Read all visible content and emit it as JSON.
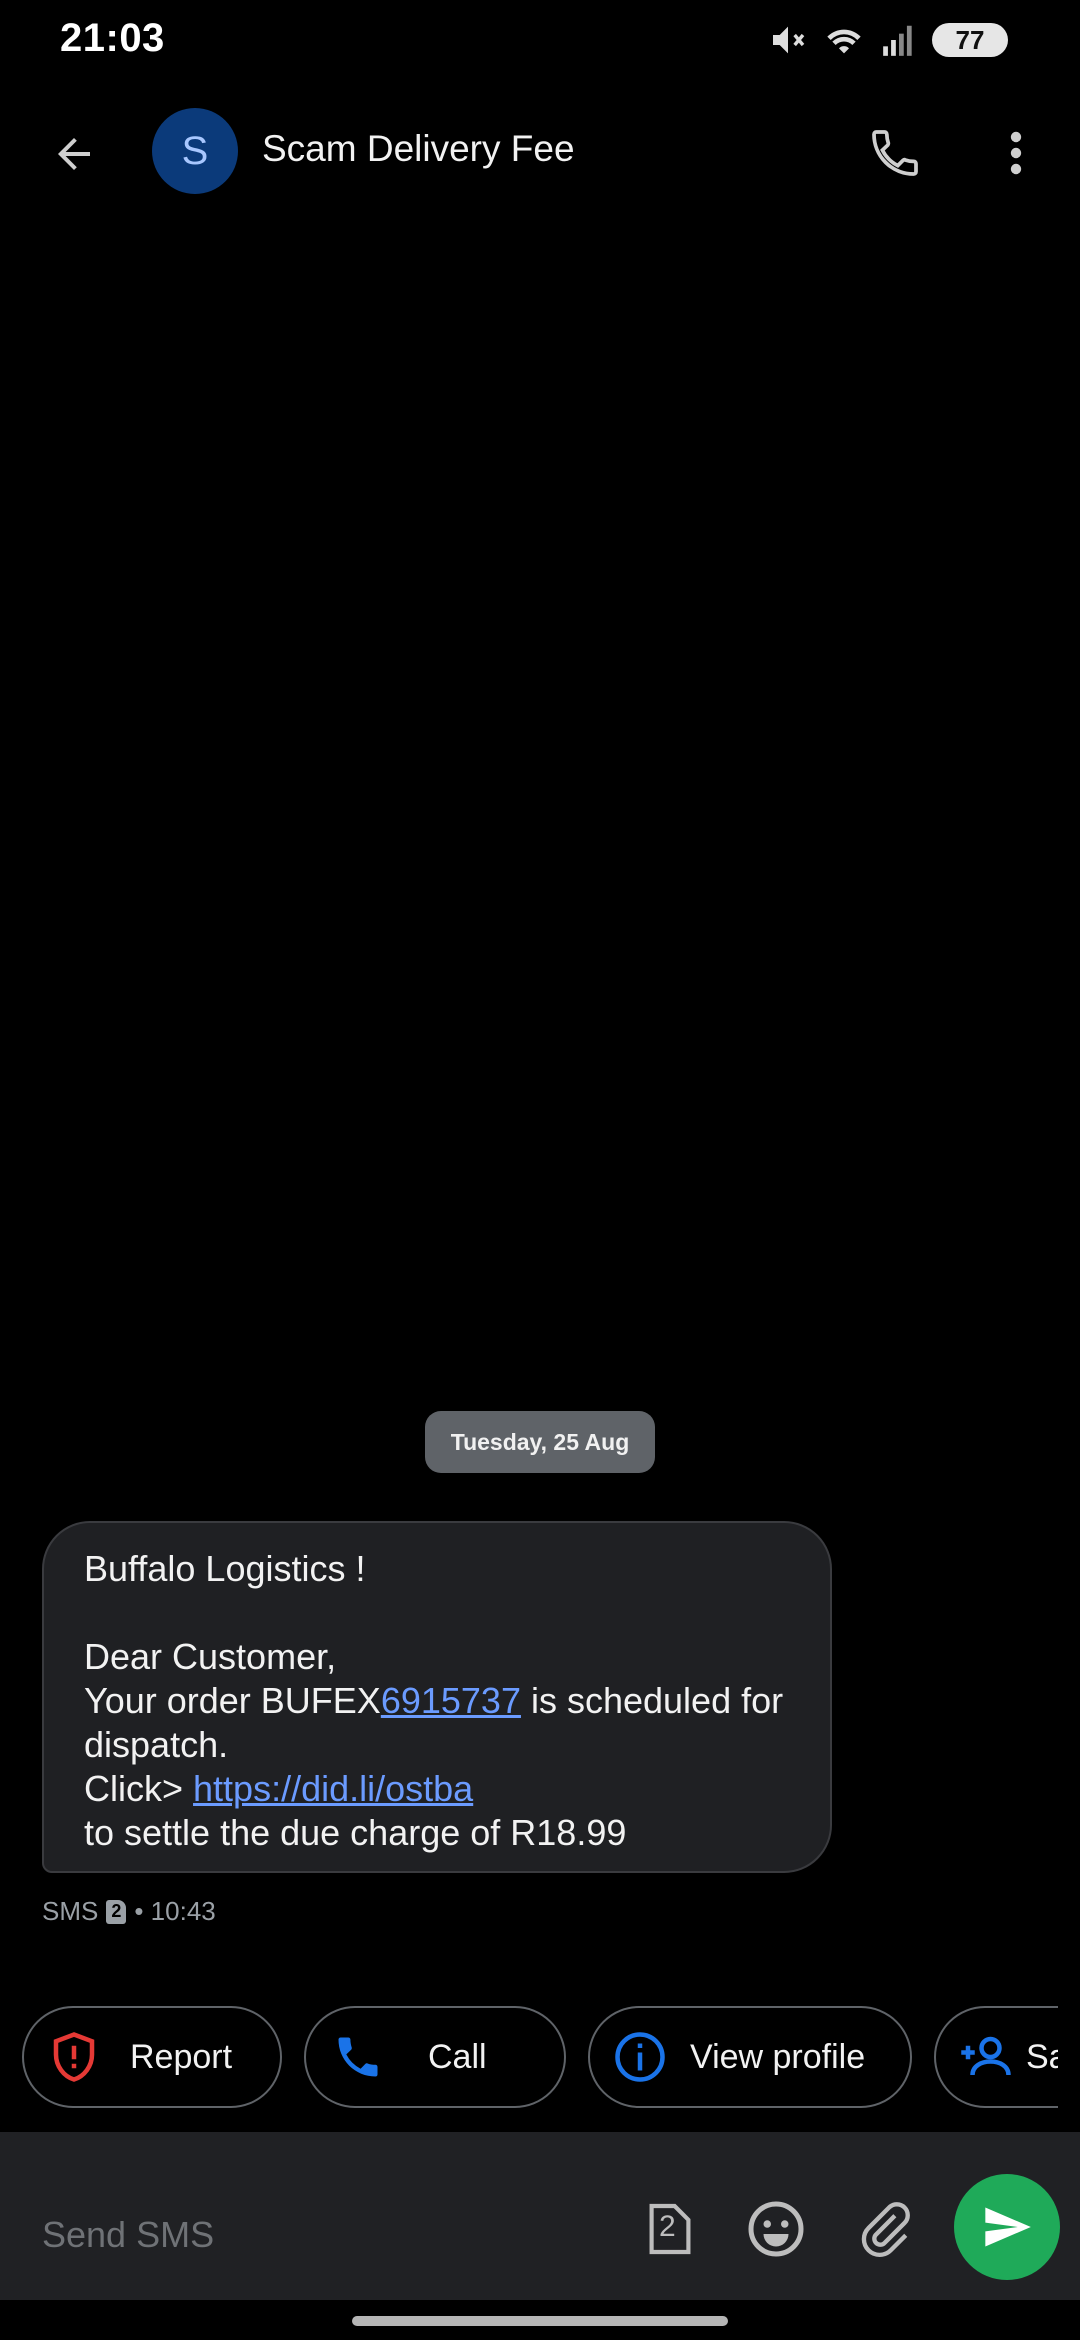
{
  "status_bar": {
    "time": "21:03",
    "battery": "77",
    "icons": [
      "mute-icon",
      "wifi-icon",
      "signal-icon",
      "battery-icon"
    ]
  },
  "header": {
    "avatar_letter": "S",
    "title": "Scam Delivery Fee",
    "icons": [
      "back-arrow-icon",
      "phone-icon",
      "more-vert-icon"
    ]
  },
  "date_chip": "Tuesday, 25 Aug",
  "message": {
    "line1": "Buffalo Logistics !",
    "line2": "Dear Customer,",
    "line3_prefix": "Your order BUFEX",
    "line3_link": "6915737",
    "line3_suffix": " is scheduled for",
    "line4": "dispatch.",
    "line5_prefix": "Click> ",
    "line5_link": "https://did.li/ostba",
    "line6": "to settle the due charge of R18.99",
    "meta_type": "SMS",
    "meta_sim": "2",
    "meta_time": "• 10:43"
  },
  "chips": {
    "report": "Report",
    "call": "Call",
    "view_profile": "View profile",
    "save": "Sa"
  },
  "compose": {
    "placeholder": "Send SMS",
    "sim": "2"
  },
  "colors": {
    "background": "#000000",
    "bubble": "#1f2023",
    "link": "#6b9bff",
    "send_button": "#1faa59",
    "report_icon": "#e53935",
    "accent_blue": "#1a73e8"
  }
}
